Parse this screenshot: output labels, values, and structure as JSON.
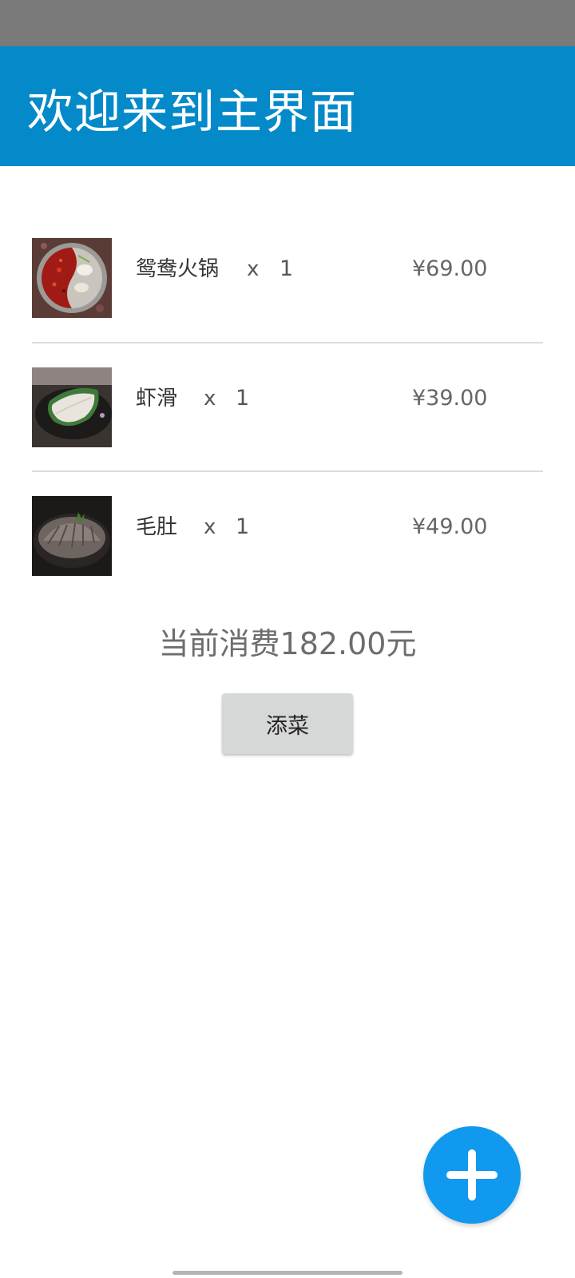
{
  "header": {
    "title": "欢迎来到主界面"
  },
  "orders": [
    {
      "name": "鸳鸯火锅",
      "multiplier": "x",
      "quantity": "1",
      "price": "¥69.00",
      "image": "mandarin-duck-hotpot-photo"
    },
    {
      "name": "虾滑",
      "multiplier": "x",
      "quantity": "1",
      "price": "¥39.00",
      "image": "shrimp-paste-photo"
    },
    {
      "name": "毛肚",
      "multiplier": "x",
      "quantity": "1",
      "price": "¥49.00",
      "image": "tripe-photo"
    }
  ],
  "summary": {
    "total_text": "当前消费182.00元"
  },
  "actions": {
    "add_dish_label": "添菜",
    "fab_icon": "plus-icon"
  },
  "colors": {
    "app_bar": "#0489c9",
    "status_bar": "#7a7a7a",
    "fab": "#1199ef",
    "button": "#d6d7d7"
  }
}
